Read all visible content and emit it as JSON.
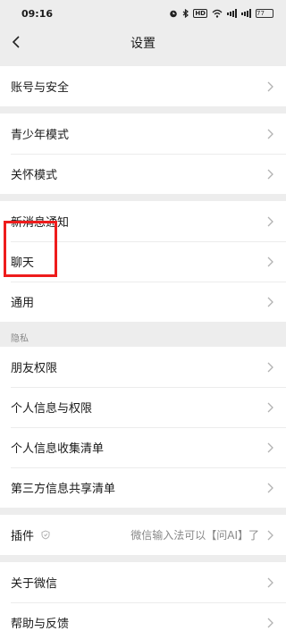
{
  "status_bar": {
    "time": "09:16",
    "hd_label": "HD",
    "battery": "77"
  },
  "nav": {
    "title": "设置",
    "back_icon": "chevron-left-icon"
  },
  "groups": [
    {
      "items": [
        {
          "label": "账号与安全"
        }
      ]
    },
    {
      "items": [
        {
          "label": "青少年模式"
        },
        {
          "label": "关怀模式"
        }
      ]
    },
    {
      "items": [
        {
          "label": "新消息通知"
        },
        {
          "label": "聊天"
        },
        {
          "label": "通用"
        }
      ]
    }
  ],
  "privacy": {
    "section_title": "隐私",
    "items": [
      {
        "label": "朋友权限"
      },
      {
        "label": "个人信息与权限"
      },
      {
        "label": "个人信息收集清单"
      },
      {
        "label": "第三方信息共享清单"
      }
    ]
  },
  "plugins": {
    "label": "插件",
    "value": "微信输入法可以【问AI】了",
    "icon": "shield-icon"
  },
  "about": {
    "items": [
      {
        "label": "关于微信"
      },
      {
        "label": "帮助与反馈"
      }
    ]
  },
  "highlight_color": "#ee1c1c"
}
